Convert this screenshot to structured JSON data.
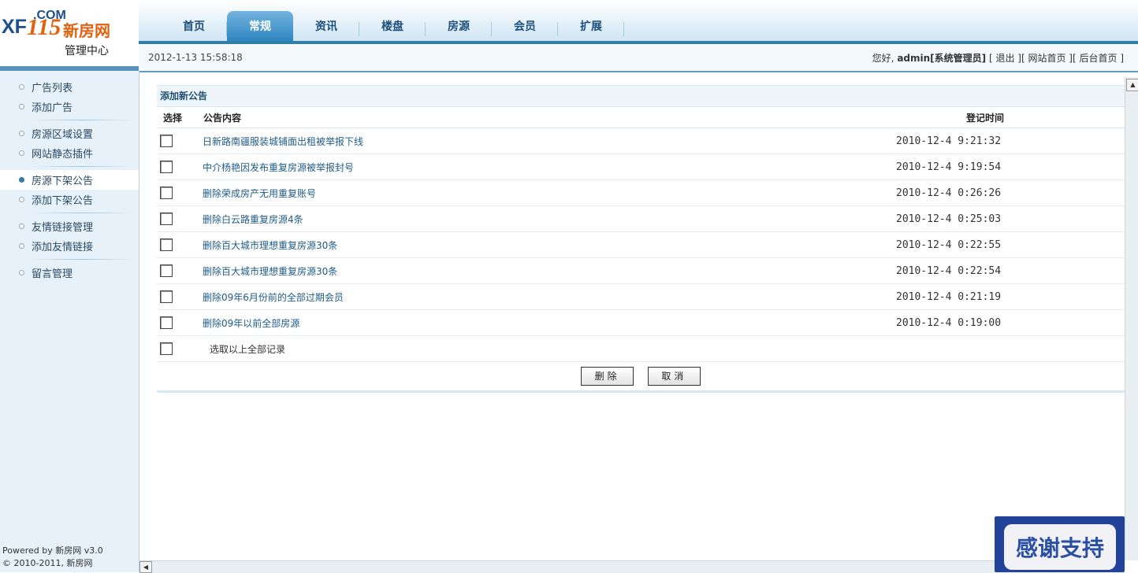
{
  "logo": {
    "com": ".COM",
    "xf": "XF",
    "num": "115",
    "cn": "新房网",
    "subtitle": "管理中心"
  },
  "nav": {
    "tabs": [
      {
        "label": "首页"
      },
      {
        "label": "常规",
        "active": true
      },
      {
        "label": "资讯"
      },
      {
        "label": "楼盘"
      },
      {
        "label": "房源"
      },
      {
        "label": "会员"
      },
      {
        "label": "扩展"
      }
    ]
  },
  "infobar": {
    "datetime": "2012-1-13 15:58:18",
    "greeting": "您好,",
    "username": "admin[系统管理员]",
    "logout": "退出",
    "site_home": "网站首页",
    "admin_home": "后台首页"
  },
  "sidebar": {
    "groups": [
      [
        "广告列表",
        "添加广告"
      ],
      [
        "房源区域设置",
        "网站静态插件"
      ],
      [
        "房源下架公告",
        "添加下架公告"
      ],
      [
        "友情链接管理",
        "添加友情链接"
      ],
      [
        "留言管理"
      ]
    ],
    "active": "房源下架公告"
  },
  "footer": {
    "line1": "Powered by 新房网 v3.0",
    "line2": "© 2010-2011, 新房网"
  },
  "panel": {
    "title": "添加新公告",
    "columns": {
      "select": "选择",
      "content": "公告内容",
      "time": "登记时间"
    },
    "rows": [
      {
        "content": "日新路南疆服装城铺面出租被举报下线",
        "time": "2010-12-4 9:21:32"
      },
      {
        "content": "中介杨艳因发布重复房源被举报封号",
        "time": "2010-12-4 9:19:54"
      },
      {
        "content": "删除荣成房产无用重复账号",
        "time": "2010-12-4 0:26:26"
      },
      {
        "content": "删除白云路重复房源4条",
        "time": "2010-12-4 0:25:03"
      },
      {
        "content": "删除百大城市理想重复房源30条",
        "time": "2010-12-4 0:22:55"
      },
      {
        "content": "删除百大城市理想重复房源30条",
        "time": "2010-12-4 0:22:54"
      },
      {
        "content": "删除09年6月份前的全部过期会员",
        "time": "2010-12-4 0:21:19"
      },
      {
        "content": "删除09年以前全部房源",
        "time": "2010-12-4 0:19:00"
      }
    ],
    "select_all": "选取以上全部记录",
    "delete_btn": "删除",
    "cancel_btn": "取消"
  },
  "overlay": {
    "text": "感谢支持"
  },
  "colors": {
    "accent": "#2f7fa6",
    "link": "#1f5b87",
    "sidebar_bg": "#e6f1f9"
  }
}
